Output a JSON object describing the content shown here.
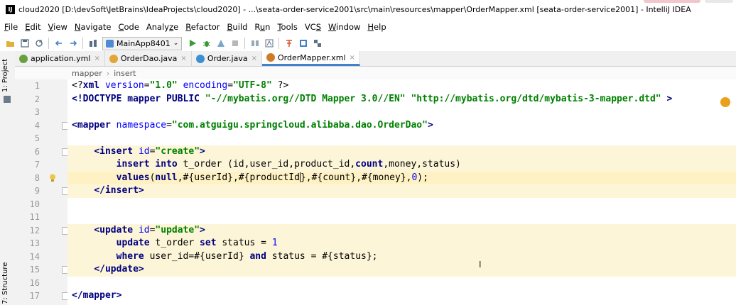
{
  "window": {
    "title": "cloud2020 [D:\\devSoft\\JetBrains\\IdeaProjects\\cloud2020] - ...\\seata-order-service2001\\src\\main\\resources\\mapper\\OrderMapper.xml [seata-order-service2001] - IntelliJ IDEA",
    "app_icon_text": "IJ"
  },
  "menu": [
    {
      "label": "File",
      "u": "F",
      "rest": "ile"
    },
    {
      "label": "Edit",
      "u": "E",
      "rest": "dit"
    },
    {
      "label": "View",
      "u": "V",
      "rest": "iew"
    },
    {
      "label": "Navigate",
      "u": "N",
      "rest": "avigate"
    },
    {
      "label": "Code",
      "u": "C",
      "rest": "ode"
    },
    {
      "label": "Analyze",
      "pre": "Analy",
      "u": "z",
      "rest": "e"
    },
    {
      "label": "Refactor",
      "u": "R",
      "rest": "efactor"
    },
    {
      "label": "Build",
      "u": "B",
      "rest": "uild"
    },
    {
      "label": "Run",
      "pre": "R",
      "u": "u",
      "rest": "n"
    },
    {
      "label": "Tools",
      "u": "T",
      "rest": "ools"
    },
    {
      "label": "VCS",
      "pre": "VC",
      "u": "S",
      "rest": ""
    },
    {
      "label": "Window",
      "u": "W",
      "rest": "indow"
    },
    {
      "label": "Help",
      "u": "H",
      "rest": "elp"
    }
  ],
  "toolbar": {
    "run_config": "MainApp8401",
    "icons": [
      "open-icon",
      "save-icon",
      "sync-icon",
      "back-icon",
      "forward-icon",
      "build-icon",
      "run-icon",
      "debug-icon",
      "coverage-icon",
      "stop-icon",
      "structure-icon",
      "sdk-icon",
      "search-icon",
      "translate-icon",
      "vcs-icon"
    ]
  },
  "side": {
    "project_label": "1: Project",
    "structure_label": "7: Structure"
  },
  "tabs": [
    {
      "label": "application.yml",
      "icon": "yml-icon",
      "color": "#6a9f3e",
      "active": false
    },
    {
      "label": "OrderDao.java",
      "icon": "interface-icon",
      "color": "#e0a637",
      "active": false
    },
    {
      "label": "Order.java",
      "icon": "class-icon",
      "color": "#3c8fd1",
      "active": false
    },
    {
      "label": "OrderMapper.xml",
      "icon": "xml-icon",
      "color": "#d07b2a",
      "active": true
    }
  ],
  "breadcrumb": [
    "mapper",
    "insert"
  ],
  "editor": {
    "line_numbers": [
      "1",
      "2",
      "3",
      "4",
      "5",
      "6",
      "7",
      "8",
      "9",
      "10",
      "11",
      "12",
      "13",
      "14",
      "15",
      "16",
      "17"
    ],
    "current_line": 8
  },
  "colors": {
    "highlight": "#fdf5d8",
    "tag": "#000080",
    "string": "#008000",
    "number": "#0000ff"
  }
}
